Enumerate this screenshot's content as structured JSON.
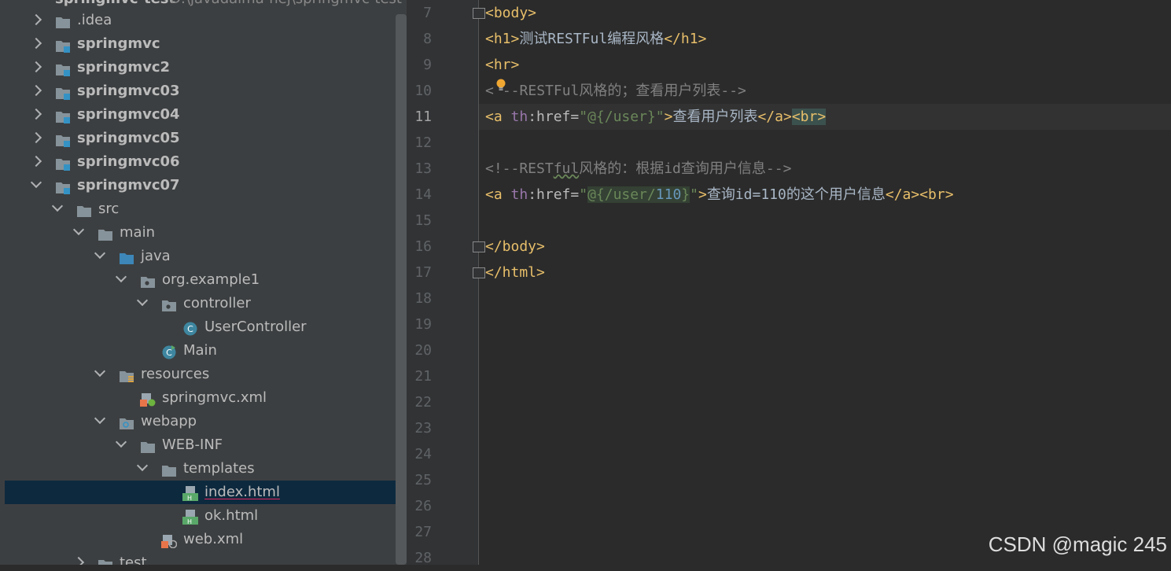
{
  "tree_header": {
    "name": "springmvc-test",
    "path": "D:\\javadaima-hej\\springmvc-test"
  },
  "tree": [
    {
      "label": ".idea",
      "icon": "folder-icon",
      "arrow": "right",
      "depth": 0,
      "bold": false
    },
    {
      "label": "springmvc",
      "icon": "module-icon",
      "arrow": "right",
      "depth": 0,
      "bold": true
    },
    {
      "label": "springmvc2",
      "icon": "module-icon",
      "arrow": "right",
      "depth": 0,
      "bold": true
    },
    {
      "label": "springmvc03",
      "icon": "module-icon",
      "arrow": "right",
      "depth": 0,
      "bold": true
    },
    {
      "label": "springmvc04",
      "icon": "module-icon",
      "arrow": "right",
      "depth": 0,
      "bold": true
    },
    {
      "label": "springmvc05",
      "icon": "module-icon",
      "arrow": "right",
      "depth": 0,
      "bold": true
    },
    {
      "label": "springmvc06",
      "icon": "module-icon",
      "arrow": "right",
      "depth": 0,
      "bold": true
    },
    {
      "label": "springmvc07",
      "icon": "module-icon",
      "arrow": "down",
      "depth": 0,
      "bold": true
    },
    {
      "label": "src",
      "icon": "folder-icon",
      "arrow": "down",
      "depth": 1,
      "bold": false
    },
    {
      "label": "main",
      "icon": "folder-icon",
      "arrow": "down",
      "depth": 2,
      "bold": false
    },
    {
      "label": "java",
      "icon": "source-folder-icon",
      "arrow": "down",
      "depth": 3,
      "bold": false
    },
    {
      "label": "org.example1",
      "icon": "package-icon",
      "arrow": "down",
      "depth": 4,
      "bold": false
    },
    {
      "label": "controller",
      "icon": "package-icon",
      "arrow": "down",
      "depth": 5,
      "bold": false
    },
    {
      "label": "UserController",
      "icon": "class-icon",
      "arrow": "none",
      "depth": 6,
      "bold": false
    },
    {
      "label": "Main",
      "icon": "main-class-icon",
      "arrow": "none",
      "depth": 5,
      "bold": false
    },
    {
      "label": "resources",
      "icon": "resources-folder-icon",
      "arrow": "down",
      "depth": 3,
      "bold": false
    },
    {
      "label": "springmvc.xml",
      "icon": "spring-xml-icon",
      "arrow": "none",
      "depth": 4,
      "bold": false
    },
    {
      "label": "webapp",
      "icon": "web-folder-icon",
      "arrow": "down",
      "depth": 3,
      "bold": false
    },
    {
      "label": "WEB-INF",
      "icon": "folder-icon",
      "arrow": "down",
      "depth": 4,
      "bold": false
    },
    {
      "label": "templates",
      "icon": "folder-icon",
      "arrow": "down",
      "depth": 5,
      "bold": false
    },
    {
      "label": "index.html",
      "icon": "html-file-icon",
      "arrow": "none",
      "depth": 6,
      "bold": false,
      "selected": true
    },
    {
      "label": "ok.html",
      "icon": "html-file-icon",
      "arrow": "none",
      "depth": 6,
      "bold": false
    },
    {
      "label": "web.xml",
      "icon": "web-xml-icon",
      "arrow": "none",
      "depth": 5,
      "bold": false
    },
    {
      "label": "test",
      "icon": "folder-icon",
      "arrow": "right",
      "depth": 2,
      "bold": false
    }
  ],
  "line_numbers": [
    "7",
    "8",
    "9",
    "10",
    "11",
    "12",
    "13",
    "14",
    "15",
    "16",
    "17",
    "18",
    "19",
    "20",
    "21",
    "22",
    "23",
    "24",
    "25",
    "26",
    "27",
    "28"
  ],
  "current_line": "11",
  "code": {
    "l7": {
      "t1": "<body>"
    },
    "l8": {
      "t1": "<h1>",
      "text": "测试RESTFul编程风格",
      "t2": "</h1>"
    },
    "l9": {
      "t1": "<hr>"
    },
    "l10": {
      "c1": "<",
      "c2": "--RESTFul风格的；查看用户列表-->"
    },
    "l11": {
      "t1": "<a ",
      "ns": "th",
      "attr": ":href=",
      "q1": "\"",
      "expr": "@{/user}",
      "q2": "\"",
      "t2": ">",
      "text": "查看用户列表",
      "t3": "</a>",
      "t4": "<br>"
    },
    "l13": {
      "c1": "<!--REST",
      "c2": "ful",
      "c3": "风格的：根据id查询用户信息-->"
    },
    "l14": {
      "t1": "<a ",
      "ns": "th",
      "attr": ":href=",
      "q1": "\"",
      "expr_a": "@{/user/",
      "expr_num": "110",
      "expr_b": "}",
      "q2": "\"",
      "t2": ">",
      "text": "查询id=110的这个用户信息",
      "t3": "</a>",
      "t4": "<br>"
    },
    "l16": {
      "t1": "</body>"
    },
    "l17": {
      "t1": "</html>"
    }
  },
  "watermark": "CSDN @magic 245",
  "colors": {
    "tree_bg": "#3c3f41",
    "editor_bg": "#2b2b2b",
    "tag": "#e8bf6a",
    "selection": "#0d293e"
  }
}
